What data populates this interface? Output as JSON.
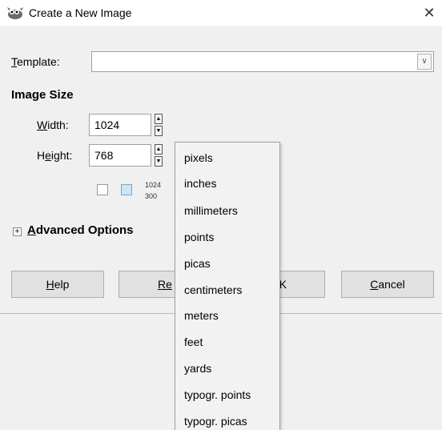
{
  "window": {
    "title": "Create a New Image",
    "close_glyph": "✕"
  },
  "template": {
    "label_u": "T",
    "label_rest": "emplate:",
    "value": "",
    "arrow": "∨"
  },
  "image_size": {
    "title": "Image Size",
    "width_label_u": "W",
    "width_label_rest": "idth:",
    "width_value": "1024",
    "height_label_pre": "H",
    "height_label_u": "e",
    "height_label_rest": "ight:",
    "height_value": "768",
    "info_line1": "1024",
    "info_line2": "300"
  },
  "advanced": {
    "expander": "+",
    "label_u": "A",
    "label_rest": "dvanced Options"
  },
  "buttons": {
    "help_u": "H",
    "help_rest": "elp",
    "reset_text": "Re",
    "ok_u": "O",
    "ok_rest": "K",
    "cancel_u": "C",
    "cancel_rest": "ancel"
  },
  "units_menu": [
    "pixels",
    "inches",
    "millimeters",
    "points",
    "picas",
    "centimeters",
    "meters",
    "feet",
    "yards",
    "typogr. points",
    "typogr. picas"
  ],
  "icons": {
    "app": "gimp-icon",
    "portrait": "portrait-icon",
    "landscape": "landscape-icon"
  }
}
